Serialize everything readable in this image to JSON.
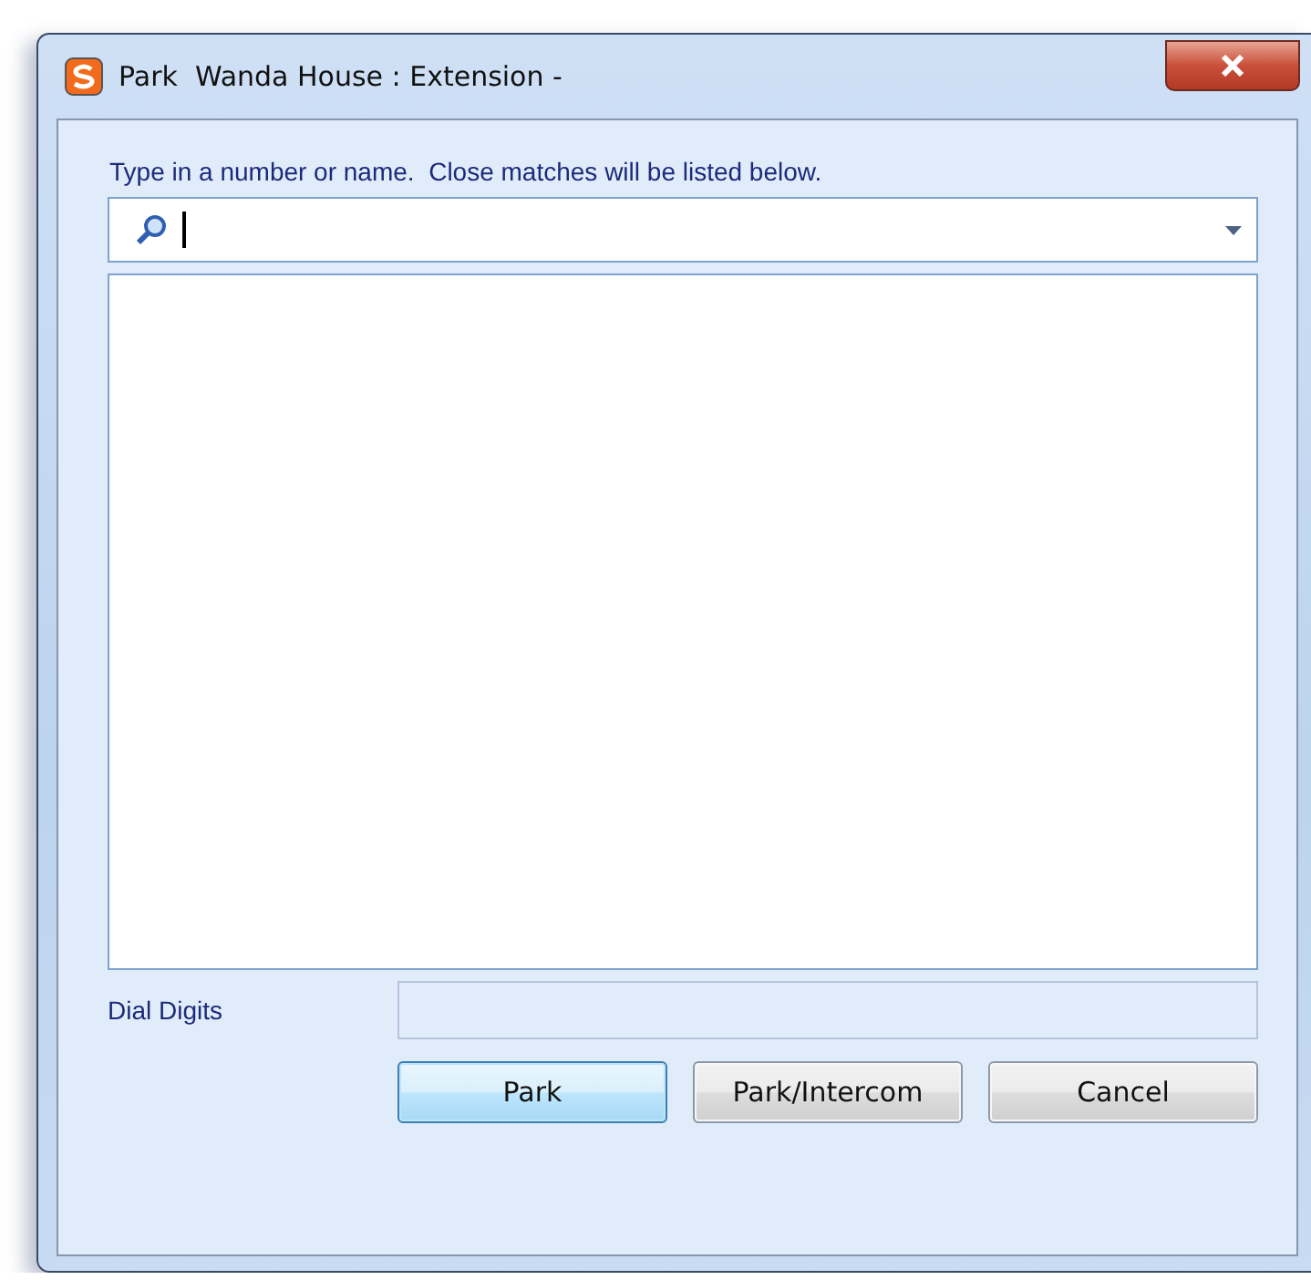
{
  "window": {
    "title": "Park  Wanda House : Extension -"
  },
  "prompt": "Type in a number or name.  Close matches will be listed below.",
  "search": {
    "focused": true
  },
  "dial_digits": {
    "label": "Dial Digits",
    "disabled": true
  },
  "buttons": [
    {
      "label": "Park",
      "default": true
    },
    {
      "label": "Park/Intercom",
      "default": false
    },
    {
      "label": "Cancel",
      "default": false
    }
  ]
}
